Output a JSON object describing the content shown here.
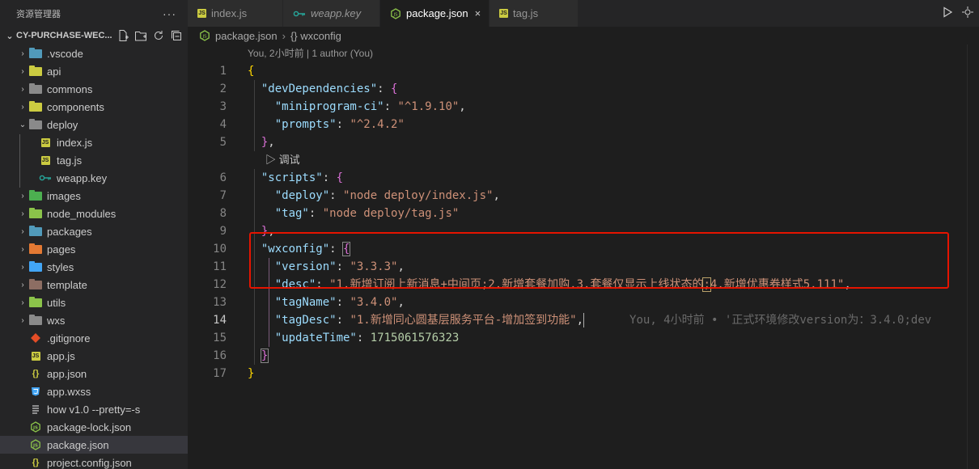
{
  "sidebar": {
    "title": "资源管理器",
    "more": "···",
    "project": "CY-PURCHASE-WEC...",
    "items": [
      {
        "label": ".vscode",
        "kind": "folder",
        "color": "#519aba",
        "depth": 0,
        "twisty": "›"
      },
      {
        "label": "api",
        "kind": "folder",
        "color": "#cbcb41",
        "depth": 0,
        "twisty": "›"
      },
      {
        "label": "commons",
        "kind": "folder",
        "color": "#8a8a8a",
        "depth": 0,
        "twisty": "›"
      },
      {
        "label": "components",
        "kind": "folder",
        "color": "#cbcb41",
        "depth": 0,
        "twisty": "›"
      },
      {
        "label": "deploy",
        "kind": "folder-open",
        "color": "#8a8a8a",
        "depth": 0,
        "twisty": "⌄"
      },
      {
        "label": "index.js",
        "kind": "js",
        "color": "#cbcb41",
        "depth": 1,
        "twisty": ""
      },
      {
        "label": "tag.js",
        "kind": "js",
        "color": "#cbcb41",
        "depth": 1,
        "twisty": ""
      },
      {
        "label": "weapp.key",
        "kind": "key",
        "color": "#26a69a",
        "depth": 1,
        "twisty": ""
      },
      {
        "label": "images",
        "kind": "folder",
        "color": "#4caf50",
        "depth": 0,
        "twisty": "›"
      },
      {
        "label": "node_modules",
        "kind": "folder",
        "color": "#8bc34a",
        "depth": 0,
        "twisty": "›"
      },
      {
        "label": "packages",
        "kind": "folder",
        "color": "#519aba",
        "depth": 0,
        "twisty": "›"
      },
      {
        "label": "pages",
        "kind": "folder",
        "color": "#e37933",
        "depth": 0,
        "twisty": "›"
      },
      {
        "label": "styles",
        "kind": "folder",
        "color": "#42a5f5",
        "depth": 0,
        "twisty": "›"
      },
      {
        "label": "template",
        "kind": "folder",
        "color": "#8d6e63",
        "depth": 0,
        "twisty": "›"
      },
      {
        "label": "utils",
        "kind": "folder",
        "color": "#8bc34a",
        "depth": 0,
        "twisty": "›"
      },
      {
        "label": "wxs",
        "kind": "folder",
        "color": "#8a8a8a",
        "depth": 0,
        "twisty": "›"
      },
      {
        "label": ".gitignore",
        "kind": "git",
        "color": "#e44d26",
        "depth": 0,
        "twisty": ""
      },
      {
        "label": "app.js",
        "kind": "js",
        "color": "#cbcb41",
        "depth": 0,
        "twisty": ""
      },
      {
        "label": "app.json",
        "kind": "json",
        "color": "#cbcb41",
        "depth": 0,
        "twisty": ""
      },
      {
        "label": "app.wxss",
        "kind": "css",
        "color": "#42a5f5",
        "depth": 0,
        "twisty": ""
      },
      {
        "label": "how v1.0 --pretty=-s",
        "kind": "file",
        "color": "#cccccc",
        "depth": 0,
        "twisty": ""
      },
      {
        "label": "package-lock.json",
        "kind": "node",
        "color": "#8bc34a",
        "depth": 0,
        "twisty": ""
      },
      {
        "label": "package.json",
        "kind": "node",
        "color": "#8bc34a",
        "depth": 0,
        "twisty": "",
        "active": true
      },
      {
        "label": "project.config.json",
        "kind": "json",
        "color": "#cbcb41",
        "depth": 0,
        "twisty": ""
      }
    ]
  },
  "tabs": [
    {
      "label": "index.js",
      "icon": "js",
      "active": false,
      "italic": false
    },
    {
      "label": "weapp.key",
      "icon": "key",
      "active": false,
      "italic": true
    },
    {
      "label": "package.json",
      "icon": "node",
      "active": true,
      "italic": false
    },
    {
      "label": "tag.js",
      "icon": "js",
      "active": false,
      "italic": false
    }
  ],
  "tab_close": "×",
  "breadcrumb": {
    "file": "package.json",
    "sep": "›",
    "node": "{} wxconfig"
  },
  "editor": {
    "codelens_top": "You, 2小时前 | 1 author (You)",
    "codelens_debug": "▷ 调试",
    "current_line": 14,
    "blame": "You, 4小时前 • '正式环境修改version为：3.4.0;dev",
    "lines": [
      {
        "n": "1",
        "tokens": [
          {
            "t": "b1",
            "v": "{"
          }
        ]
      },
      {
        "n": "2",
        "tokens": [
          {
            "t": "p",
            "v": "  "
          },
          {
            "t": "k",
            "v": "\"devDependencies\""
          },
          {
            "t": "p",
            "v": ": "
          },
          {
            "t": "b2",
            "v": "{"
          }
        ]
      },
      {
        "n": "3",
        "tokens": [
          {
            "t": "p",
            "v": "    "
          },
          {
            "t": "k",
            "v": "\"miniprogram-ci\""
          },
          {
            "t": "p",
            "v": ": "
          },
          {
            "t": "s",
            "v": "\"^1.9.10\""
          },
          {
            "t": "p",
            "v": ","
          }
        ]
      },
      {
        "n": "4",
        "tokens": [
          {
            "t": "p",
            "v": "    "
          },
          {
            "t": "k",
            "v": "\"prompts\""
          },
          {
            "t": "p",
            "v": ": "
          },
          {
            "t": "s",
            "v": "\"^2.4.2\""
          }
        ]
      },
      {
        "n": "5",
        "tokens": [
          {
            "t": "p",
            "v": "  "
          },
          {
            "t": "b2",
            "v": "}"
          },
          {
            "t": "p",
            "v": ","
          }
        ]
      },
      {
        "lens": true
      },
      {
        "n": "6",
        "tokens": [
          {
            "t": "p",
            "v": "  "
          },
          {
            "t": "k",
            "v": "\"scripts\""
          },
          {
            "t": "p",
            "v": ": "
          },
          {
            "t": "b2",
            "v": "{"
          }
        ]
      },
      {
        "n": "7",
        "tokens": [
          {
            "t": "p",
            "v": "    "
          },
          {
            "t": "k",
            "v": "\"deploy\""
          },
          {
            "t": "p",
            "v": ": "
          },
          {
            "t": "s",
            "v": "\"node deploy/index.js\""
          },
          {
            "t": "p",
            "v": ","
          }
        ]
      },
      {
        "n": "8",
        "tokens": [
          {
            "t": "p",
            "v": "    "
          },
          {
            "t": "k",
            "v": "\"tag\""
          },
          {
            "t": "p",
            "v": ": "
          },
          {
            "t": "s",
            "v": "\"node deploy/tag.js\""
          }
        ]
      },
      {
        "n": "9",
        "tokens": [
          {
            "t": "p",
            "v": "  "
          },
          {
            "t": "b2",
            "v": "}"
          },
          {
            "t": "p",
            "v": ","
          }
        ]
      },
      {
        "n": "10",
        "tokens": [
          {
            "t": "p",
            "v": "  "
          },
          {
            "t": "k",
            "v": "\"wxconfig\""
          },
          {
            "t": "p",
            "v": ": "
          },
          {
            "t": "b2",
            "v": "{",
            "box": "bracket-box"
          }
        ]
      },
      {
        "n": "11",
        "tokens": [
          {
            "t": "p",
            "v": "    "
          },
          {
            "t": "k",
            "v": "\"version\""
          },
          {
            "t": "p",
            "v": ": "
          },
          {
            "t": "s",
            "v": "\"3.3.3\""
          },
          {
            "t": "p",
            "v": ","
          }
        ]
      },
      {
        "n": "12",
        "tokens": [
          {
            "t": "p",
            "v": "    "
          },
          {
            "t": "k",
            "v": "\"desc\""
          },
          {
            "t": "p",
            "v": ": "
          },
          {
            "t": "s",
            "v": "\"1.新增订阅上新消息+中间页;2.新增套餐加购.3.套餐仅显示上线状态的"
          },
          {
            "t": "s",
            "v": ";",
            "box": "sel-box"
          },
          {
            "t": "s",
            "v": "4.新增优惠券样式5.111\""
          },
          {
            "t": "p",
            "v": ","
          }
        ]
      },
      {
        "n": "13",
        "tokens": [
          {
            "t": "p",
            "v": "    "
          },
          {
            "t": "k",
            "v": "\"tagName\""
          },
          {
            "t": "p",
            "v": ": "
          },
          {
            "t": "s",
            "v": "\"3.4.0\""
          },
          {
            "t": "p",
            "v": ","
          }
        ]
      },
      {
        "n": "14",
        "tokens": [
          {
            "t": "p",
            "v": "    "
          },
          {
            "t": "k",
            "v": "\"tagDesc\""
          },
          {
            "t": "p",
            "v": ": "
          },
          {
            "t": "s",
            "v": "\"1.新增同心圆基层服务平台-增加签到功能\""
          },
          {
            "t": "p",
            "v": ","
          }
        ],
        "blame": true
      },
      {
        "n": "15",
        "tokens": [
          {
            "t": "p",
            "v": "    "
          },
          {
            "t": "k",
            "v": "\"updateTime\""
          },
          {
            "t": "p",
            "v": ": "
          },
          {
            "t": "n",
            "v": "1715061576323"
          }
        ]
      },
      {
        "n": "16",
        "tokens": [
          {
            "t": "p",
            "v": "  "
          },
          {
            "t": "b2",
            "v": "}",
            "box": "bracket-box"
          }
        ]
      },
      {
        "n": "17",
        "tokens": [
          {
            "t": "b1",
            "v": "}"
          }
        ]
      }
    ]
  }
}
